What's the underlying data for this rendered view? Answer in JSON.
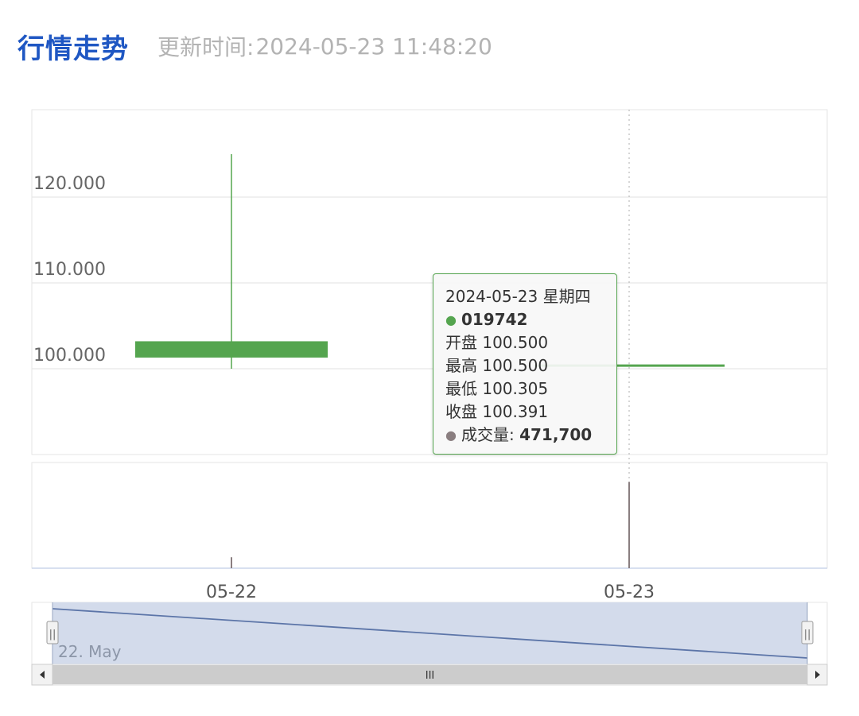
{
  "header": {
    "title": "行情走势",
    "updated_label": "更新时间:",
    "updated_value": "2024-05-23 11:48:20"
  },
  "tooltip": {
    "date": "2024-05-23 星期四",
    "series_name": "019742",
    "open_label": "开盘",
    "open_value": "100.500",
    "high_label": "最高",
    "high_value": "100.500",
    "low_label": "最低",
    "low_value": "100.305",
    "close_label": "收盘",
    "close_value": "100.391",
    "volume_label": "成交量:",
    "volume_value": "471,700"
  },
  "navigator": {
    "label": "22. May",
    "scroll_grip": "III",
    "handle_grip": "||"
  },
  "colors": {
    "title": "#1f57c3",
    "candle": "#55a54f",
    "volume": "#8a7e80",
    "navigator_fill": "#d3dbeb",
    "navigator_line": "#5c75a8",
    "crosshair": "#bbbbbb"
  },
  "chart_data": {
    "type": "candlestick",
    "categories": [
      "05-22",
      "05-23"
    ],
    "series": [
      {
        "name": "019742",
        "ohlc": [
          {
            "date": "05-22",
            "open": 101.3,
            "high": 125.0,
            "low": 100.0,
            "close": 103.2
          },
          {
            "date": "05-23",
            "open": 100.5,
            "high": 100.5,
            "low": 100.305,
            "close": 100.391
          }
        ]
      }
    ],
    "volume": [
      {
        "date": "05-22",
        "value": 60000
      },
      {
        "date": "05-23",
        "value": 471700
      }
    ],
    "yticks": [
      "100.000",
      "110.000",
      "120.000"
    ],
    "ylim": [
      90,
      130
    ],
    "volume_ylim": [
      0,
      500000
    ],
    "navigator_line": {
      "start": 105,
      "end": 100.4
    },
    "grid": true,
    "crosshair_at": "05-23"
  }
}
